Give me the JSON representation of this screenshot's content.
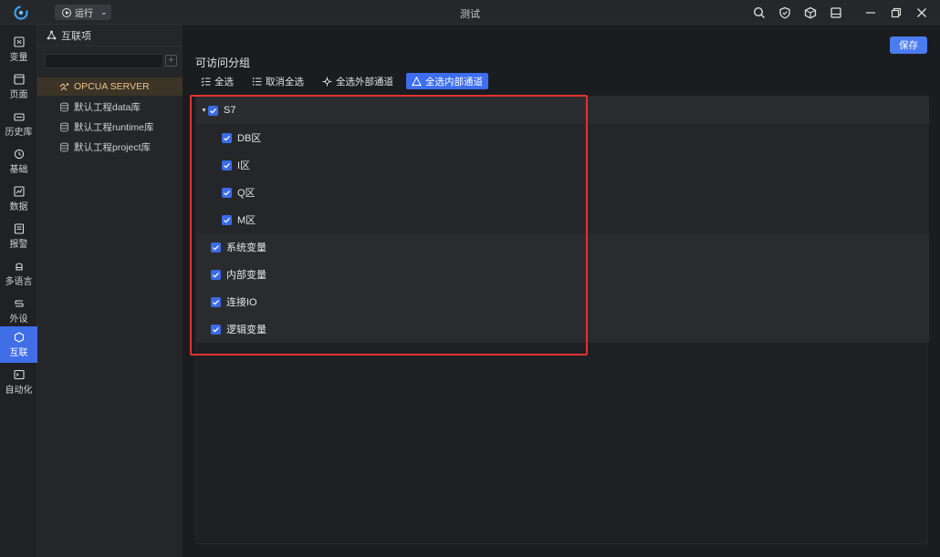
{
  "titlebar": {
    "run_label": "运行",
    "title": "测试",
    "icons": [
      "search-icon",
      "shield-icon",
      "cube-icon",
      "save-disk-icon",
      "minimize-icon",
      "restore-icon",
      "close-icon"
    ]
  },
  "leftnav": {
    "items": [
      {
        "label": "变量",
        "icon": "variable-icon"
      },
      {
        "label": "页面",
        "icon": "page-icon"
      },
      {
        "label": "历史库",
        "icon": "history-icon"
      },
      {
        "label": "基础",
        "icon": "basic-icon"
      },
      {
        "label": "数据",
        "icon": "data-icon"
      },
      {
        "label": "报警",
        "icon": "alarm-icon"
      },
      {
        "label": "多语言",
        "icon": "language-icon"
      },
      {
        "label": "外设",
        "icon": "peripheral-icon"
      },
      {
        "label": "互联",
        "icon": "interconnect-icon",
        "active": true
      },
      {
        "label": "自动化",
        "icon": "automation-icon"
      }
    ]
  },
  "treepanel": {
    "header": "互联项",
    "search_placeholder": "",
    "items": [
      {
        "label": "OPCUA SERVER",
        "icon": "opcua-icon",
        "selected": true
      },
      {
        "label": "默认工程data库",
        "icon": "database-icon"
      },
      {
        "label": "默认工程runtime库",
        "icon": "database-icon"
      },
      {
        "label": "默认工程project库",
        "icon": "database-icon"
      }
    ]
  },
  "main": {
    "save_label": "保存",
    "group_title": "可访问分组",
    "toolbar": {
      "select_all": "全选",
      "deselect_all": "取消全选",
      "select_external": "全选外部通道",
      "select_internal": "全选内部通道"
    },
    "rows": [
      {
        "label": "S7",
        "level": 0,
        "expandable": true,
        "checked": true
      },
      {
        "label": "DB区",
        "level": 1,
        "checked": true
      },
      {
        "label": "I区",
        "level": 1,
        "checked": true
      },
      {
        "label": "Q区",
        "level": 1,
        "checked": true
      },
      {
        "label": "M区",
        "level": 1,
        "checked": true
      },
      {
        "label": "系统变量",
        "level": 0,
        "checked": true
      },
      {
        "label": "内部变量",
        "level": 0,
        "checked": true
      },
      {
        "label": "连接IO",
        "level": 0,
        "checked": true
      },
      {
        "label": "逻辑变量",
        "level": 0,
        "checked": true
      }
    ]
  },
  "colors": {
    "accent": "#3d6df0",
    "highlight_box": "#e2332c",
    "selected_tree": "#f0c08a"
  }
}
